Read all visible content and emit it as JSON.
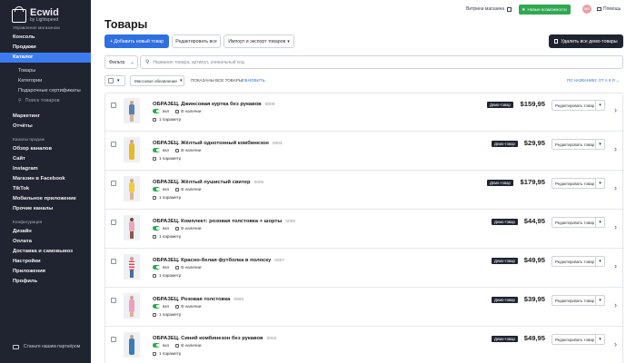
{
  "sidebar": {
    "logo": {
      "name": "Ecwid",
      "by": "by Lightspeed"
    },
    "section_manage": "Управление магазином",
    "items_top": [
      "Консоль",
      "Продажи",
      "Каталог"
    ],
    "catalog_sub": [
      "Товары",
      "Категории",
      "Подарочные сертификаты"
    ],
    "search_products": "Поиск товаров",
    "items_mid": [
      "Маркетинг",
      "Отчёты"
    ],
    "section_channels": "Каналы продаж",
    "channels": [
      "Обзор каналов",
      "Сайт",
      "Instagram",
      "Магазин в Facebook",
      "TikTok",
      "Мобильное приложение",
      "Прочие каналы"
    ],
    "section_config": "Конфигурация",
    "config": [
      "Дизайн",
      "Оплата",
      "Доставка и самовывоз",
      "Настройки",
      "Приложения",
      "Профиль"
    ],
    "partner": "Станьте нашим партнёром"
  },
  "topbar": {
    "showcase": "Витрина магазина",
    "new_features": "Новые возможности",
    "avatar_initials": "ME",
    "help": "Помощь"
  },
  "header": {
    "title": "Товары",
    "add_product": "+ Добавить новый товар",
    "edit_all": "Редактировать все",
    "import_export": "Импорт и экспорт товаров",
    "delete_demo": "Удалить все демо-товары"
  },
  "filter": {
    "label": "Фильтр",
    "search_placeholder": "Название товара, артикул, уникальный код"
  },
  "list_toolbar": {
    "sort_option": "Массовое обновление",
    "show_all": "ПОКАЗАНЫ ВСЕ ТОВАРЫ",
    "refresh": "ОБНОВИТЬ",
    "sort_by": "ПО НАЗВАНИЮ: ОТ А К Я"
  },
  "products": [
    {
      "name": "ОБРАЗЕЦ. Джинсовая куртка без рукавов",
      "sku": "0009",
      "status": "вкл",
      "stock": "В наличии",
      "params": "1 параметр",
      "badge": "Демо-товар",
      "price": "$159,95",
      "edit": "Редактировать товар"
    },
    {
      "name": "ОБРАЗЕЦ. Жёлтый однотонный комбинезон",
      "sku": "0004",
      "status": "вкл",
      "stock": "В наличии",
      "params": "1 параметр",
      "badge": "Демо-товар",
      "price": "$29,95",
      "edit": "Редактировать товар"
    },
    {
      "name": "ОБРАЗЕЦ. Жёлтый пушистый свитер",
      "sku": "0006",
      "status": "вкл",
      "stock": "В наличии",
      "params": "1 параметр",
      "badge": "Демо-товар",
      "price": "$179,95",
      "edit": "Редактировать товар"
    },
    {
      "name": "ОБРАЗЕЦ. Комплект: розовая толстовка + шорты",
      "sku": "0008",
      "status": "вкл",
      "stock": "В наличии",
      "params": "1 параметр",
      "badge": "Демо-товар",
      "price": "$44,95",
      "edit": "Редактировать товар"
    },
    {
      "name": "ОБРАЗЕЦ. Красно-белая футболка в полоску",
      "sku": "0007",
      "status": "вкл",
      "stock": "В наличии",
      "params": "1 параметр",
      "badge": "Демо-товар",
      "price": "$49,95",
      "edit": "Редактировать товар"
    },
    {
      "name": "ОБРАЗЕЦ. Розовая толстовка",
      "sku": "0005",
      "status": "вкл",
      "stock": "В наличии",
      "params": "1 параметр",
      "badge": "Демо-товар",
      "price": "$39,95",
      "edit": "Редактировать товар"
    },
    {
      "name": "ОБРАЗЕЦ. Синий комбинезон без рукавов",
      "sku": "0002",
      "status": "вкл",
      "stock": "В наличии",
      "params": "1 параметр",
      "badge": "Демо-товар",
      "price": "$49,95",
      "edit": "Редактировать товар"
    }
  ],
  "colors": {
    "sidebar_bg": "#1f2430",
    "accent": "#2f6fe0",
    "active_nav": "#3d7cf0",
    "new_features": "#2fa84f"
  }
}
